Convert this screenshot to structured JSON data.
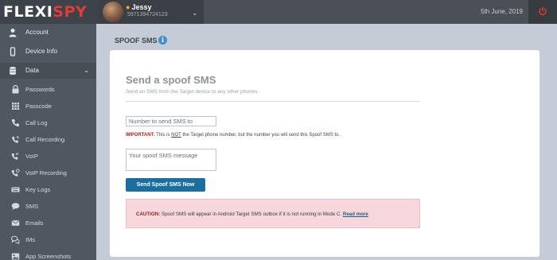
{
  "brand": {
    "logo_left": "FLEXI",
    "logo_right": "SPY"
  },
  "user": {
    "name": "Jessy",
    "phone": "5971394724123"
  },
  "header": {
    "date": "5th June, 2019"
  },
  "sidebar": {
    "top_items": [
      {
        "label": "Account",
        "icon": "user-icon"
      },
      {
        "label": "Device Info",
        "icon": "mobile-icon"
      },
      {
        "label": "Data",
        "icon": "database-icon"
      }
    ],
    "data_items": [
      {
        "label": "Passwords",
        "icon": "lock-icon"
      },
      {
        "label": "Passcode",
        "icon": "keypad-icon"
      },
      {
        "label": "Call Log",
        "icon": "phone-icon"
      },
      {
        "label": "Call Recording",
        "icon": "phone-recording-icon"
      },
      {
        "label": "VoIP",
        "icon": "voip-icon"
      },
      {
        "label": "VoIP Recording",
        "icon": "voip-recording-icon"
      },
      {
        "label": "Key Logs",
        "icon": "keyboard-icon"
      },
      {
        "label": "SMS",
        "icon": "chat-bubble-icon"
      },
      {
        "label": "Emails",
        "icon": "envelope-icon"
      },
      {
        "label": "IMs",
        "icon": "chat-bubbles-icon"
      },
      {
        "label": "App Screenshots",
        "icon": "screenshot-icon"
      }
    ]
  },
  "page": {
    "title": "SPOOF SMS"
  },
  "form": {
    "heading": "Send a spoof SMS",
    "description": "Send an SMS from the Target device to any other phones.",
    "number_placeholder": "Number to send SMS to",
    "important_prefix": "IMPORTANT:",
    "important_before": " This is ",
    "important_not": "NOT",
    "important_after": " the Target phone number, but the number you will send this Spoof SMS to.",
    "message_placeholder": "Your spoof SMS message",
    "send_label": "Send Spoof SMS Now"
  },
  "caution": {
    "prefix": "CAUTION:",
    "text": " Spoof SMS will appear in Android Target SMS outbox if it is not running in Mode C. ",
    "link": "Read more"
  },
  "colors": {
    "accent": "#1b6fa0",
    "brand_red": "#e23b3b",
    "caution_bg": "#f7d7db"
  }
}
